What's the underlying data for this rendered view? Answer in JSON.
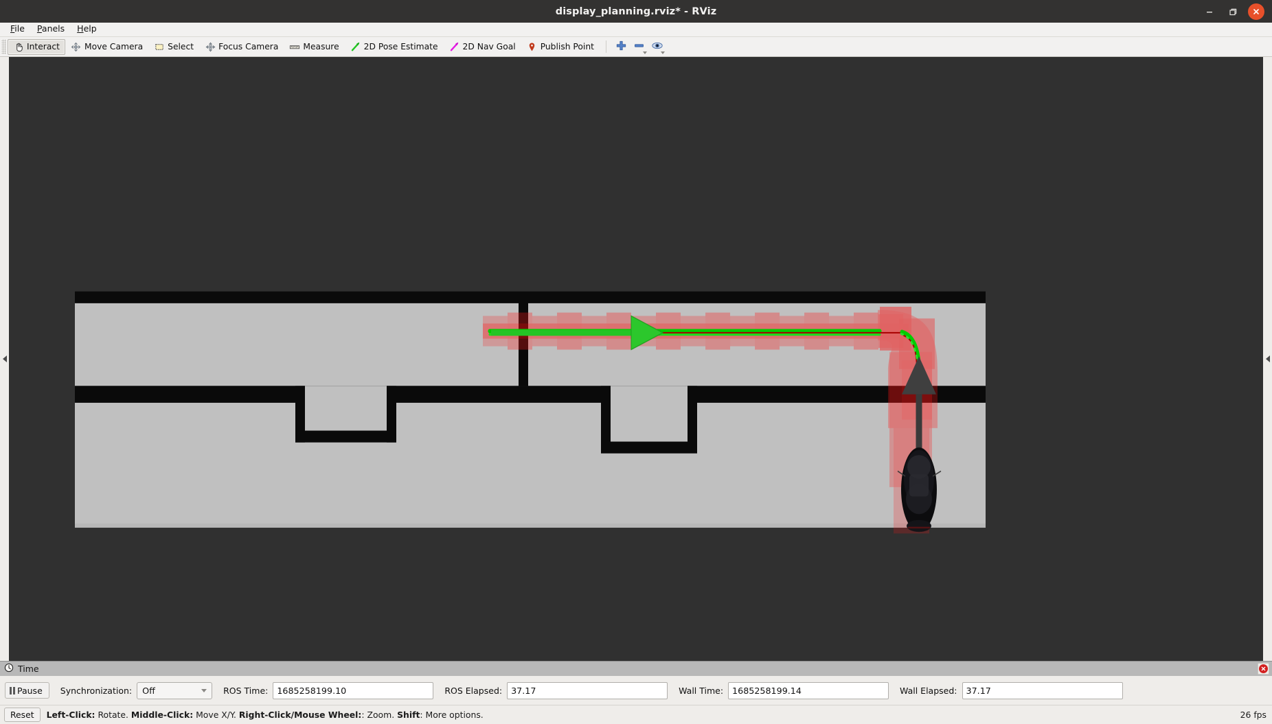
{
  "window": {
    "title": "display_planning.rviz* - RViz",
    "controls": {
      "minimize": "minimize-button",
      "maximize": "maximize-button",
      "close": "close-button"
    }
  },
  "menubar": {
    "items": [
      {
        "label": "File",
        "mnemonic": "F"
      },
      {
        "label": "Panels",
        "mnemonic": "P"
      },
      {
        "label": "Help",
        "mnemonic": "H"
      }
    ]
  },
  "toolbar": {
    "tools": [
      {
        "label": "Interact",
        "icon": "hand-cursor-icon",
        "active": true
      },
      {
        "label": "Move Camera",
        "icon": "move-camera-icon",
        "active": false
      },
      {
        "label": "Select",
        "icon": "selection-rectangle-icon",
        "active": false
      },
      {
        "label": "Focus Camera",
        "icon": "focus-camera-icon",
        "active": false
      },
      {
        "label": "Measure",
        "icon": "ruler-icon",
        "active": false
      },
      {
        "label": "2D Pose Estimate",
        "icon": "green-arrow-icon",
        "active": false
      },
      {
        "label": "2D Nav Goal",
        "icon": "magenta-arrow-icon",
        "active": false
      },
      {
        "label": "Publish Point",
        "icon": "map-pin-icon",
        "active": false
      }
    ],
    "icon_buttons": [
      {
        "name": "add-tool-button",
        "icon": "plus-icon",
        "has_menu": false
      },
      {
        "name": "remove-tool-button",
        "icon": "minus-icon",
        "has_menu": true
      },
      {
        "name": "visibility-button",
        "icon": "eye-icon",
        "has_menu": true
      }
    ]
  },
  "viewport": {
    "left_splitter_icon": "collapse-left-panel-arrow",
    "right_splitter_icon": "collapse-right-panel-arrow",
    "background_color": "#303030",
    "free_space_color": "#c0c0c0",
    "obstacle_color": "#090909",
    "costmap_color": "#ff0000",
    "path_color": "#00d400",
    "goal_arrow_color": "#3d3d3d"
  },
  "time_panel": {
    "header_title": "Time",
    "header_icon": "clock-icon",
    "close_icon": "panel-close-icon",
    "pause_label": "Pause",
    "pause_icon": "pause-icon",
    "sync_label": "Synchronization:",
    "sync_value": "Off",
    "fields": [
      {
        "label": "ROS Time:",
        "value": "1685258199.10",
        "name": "ros-time-field"
      },
      {
        "label": "ROS Elapsed:",
        "value": "37.17",
        "name": "ros-elapsed-field"
      },
      {
        "label": "Wall Time:",
        "value": "1685258199.14",
        "name": "wall-time-field"
      },
      {
        "label": "Wall Elapsed:",
        "value": "37.17",
        "name": "wall-elapsed-field"
      }
    ]
  },
  "statusbar": {
    "reset_label": "Reset",
    "hint_parts": [
      {
        "bold": "Left-Click:",
        "text": " Rotate. "
      },
      {
        "bold": "Middle-Click:",
        "text": " Move X/Y. "
      },
      {
        "bold": "Right-Click/Mouse Wheel:",
        "text": ": Zoom. "
      },
      {
        "bold": "Shift",
        "text": ": More options."
      }
    ],
    "fps": "26 fps"
  }
}
